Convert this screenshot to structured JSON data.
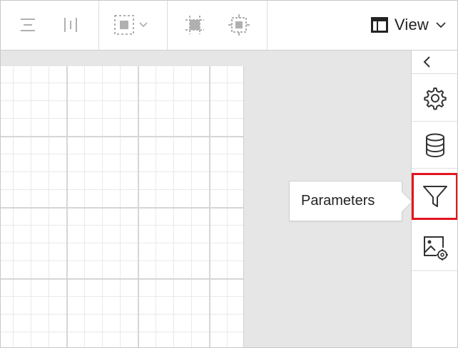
{
  "toolbar": {
    "view_label": "View",
    "icons": [
      "align-center-icon",
      "align-middle-icon",
      "select-region-icon",
      "chevron-down-icon",
      "fit-to-page-icon",
      "fit-to-width-icon",
      "layout-icon"
    ]
  },
  "sidebar": {
    "collapse_icon": "chevron-left-icon",
    "items": [
      {
        "name": "settings",
        "icon": "gear-icon"
      },
      {
        "name": "data",
        "icon": "database-icon"
      },
      {
        "name": "parameters",
        "icon": "filter-icon",
        "active": true
      },
      {
        "name": "image-properties",
        "icon": "image-settings-icon"
      }
    ]
  },
  "tooltip": {
    "text": "Parameters"
  },
  "colors": {
    "active_border": "#e3141e",
    "icon_gray": "#b0b0b0",
    "icon_dark": "#333333"
  }
}
